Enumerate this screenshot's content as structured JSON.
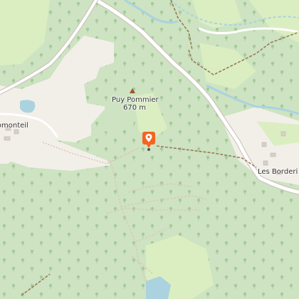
{
  "map": {
    "labels": {
      "peak_name": "Puy Pommier",
      "peak_elevation": "670 m",
      "place_left": "romonteil",
      "place_right": "Les Borderi"
    },
    "colors": {
      "forest": "#cde3c2",
      "meadow": "#dbeec2",
      "cleared": "#f2efe9",
      "road": "#ffffff",
      "road_casing": "#c8c0b6",
      "water": "#aad3df",
      "track": "#9a7a56",
      "marker": "#f26522",
      "tree_symbol": "#9fc695"
    },
    "marker_icon": "map-pin-icon",
    "peak_icon": "peak-triangle-icon"
  }
}
